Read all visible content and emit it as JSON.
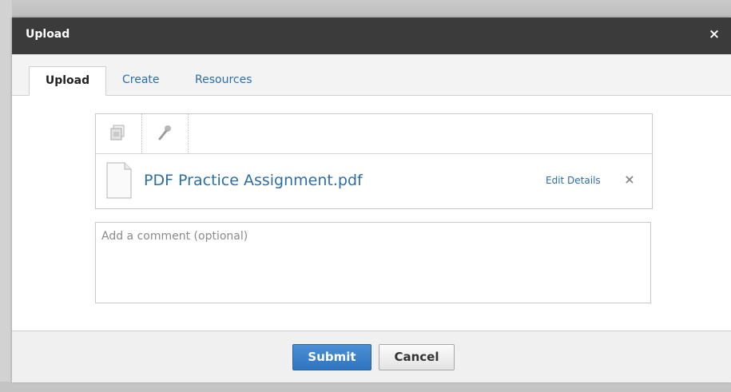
{
  "dialog": {
    "title": "Upload",
    "close_label": "×"
  },
  "tabs": [
    {
      "label": "Upload",
      "active": true
    },
    {
      "label": "Create",
      "active": false
    },
    {
      "label": "Resources",
      "active": false
    }
  ],
  "toolbar": {
    "buttons": [
      {
        "icon": "add-file-icon"
      },
      {
        "icon": "microphone-icon"
      }
    ]
  },
  "file": {
    "name": "PDF Practice Assignment.pdf",
    "edit_label": "Edit Details",
    "remove_label": "×"
  },
  "comment": {
    "placeholder": "Add a comment (optional)",
    "value": ""
  },
  "footer": {
    "submit_label": "Submit",
    "cancel_label": "Cancel"
  },
  "colors": {
    "titlebar": "#3b3b3b",
    "link": "#2e6da4",
    "submit": "#3a80c8"
  }
}
